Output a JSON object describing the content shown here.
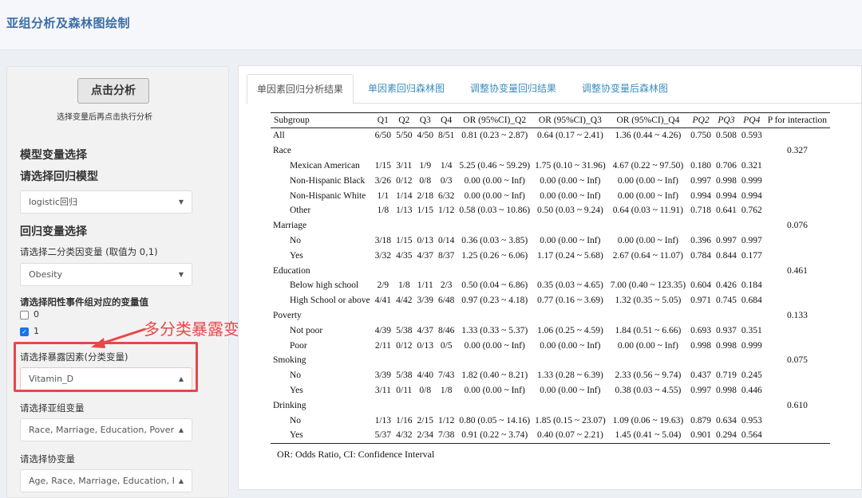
{
  "app": {
    "title": "亚组分析及森林图绘制"
  },
  "sidebar": {
    "analyze_button": "点击分析",
    "hint": "选择变量后再点击执行分析",
    "section_model": "模型变量选择",
    "model_label": "请选择回归模型",
    "model_value": "logistic回归",
    "section_reg": "回归变量选择",
    "binary_label": "请选择二分类因变量 (取值为 0,1)",
    "binary_value": "Obesity",
    "positive_label": "请选择阳性事件组对应的变量值",
    "positive_options": [
      {
        "label": "0",
        "checked": false
      },
      {
        "label": "1",
        "checked": true
      }
    ],
    "exposure_label": "请选择暴露因素(分类变量)",
    "exposure_value": "Vitamin_D",
    "subgroup_label": "请选择亚组变量",
    "subgroup_value": "Race, Marriage, Education, Poverty,",
    "covariate_label": "请选择协变量",
    "covariate_value": "Age, Race, Marriage, Education, Pove",
    "annotation": "多分类暴露变量",
    "annotation_color": "#e8474a"
  },
  "tabs": [
    {
      "label": "单因素回归分析结果",
      "active": true
    },
    {
      "label": "单因素回归森林图",
      "active": false
    },
    {
      "label": "调整协变量回归结果",
      "active": false
    },
    {
      "label": "调整协变量后森林图",
      "active": false
    }
  ],
  "table": {
    "headers": [
      "Subgroup",
      "Q1",
      "Q2",
      "Q3",
      "Q4",
      "OR (95%CI)_Q2",
      "OR (95%CI)_Q3",
      "OR (95%CI)_Q4",
      "PQ2",
      "PQ3",
      "PQ4",
      "P for interaction"
    ],
    "rows": [
      [
        "All",
        "6/50",
        "5/50",
        "4/50",
        "8/51",
        "0.81 (0.23 ~ 2.87)",
        "0.64 (0.17 ~ 2.41)",
        "1.36 (0.44 ~ 4.26)",
        "0.750",
        "0.508",
        "0.593",
        ""
      ],
      [
        "Race",
        "",
        "",
        "",
        "",
        "",
        "",
        "",
        "",
        "",
        "",
        "0.327"
      ],
      [
        "Mexican American",
        "1/15",
        "3/11",
        "1/9",
        "1/4",
        "5.25 (0.46 ~ 59.29)",
        "1.75 (0.10 ~ 31.96)",
        "4.67 (0.22 ~ 97.50)",
        "0.180",
        "0.706",
        "0.321",
        ""
      ],
      [
        "Non-Hispanic Black",
        "3/26",
        "0/12",
        "0/8",
        "0/3",
        "0.00 (0.00 ~ Inf)",
        "0.00 (0.00 ~ Inf)",
        "0.00 (0.00 ~ Inf)",
        "0.997",
        "0.998",
        "0.999",
        ""
      ],
      [
        "Non-Hispanic White",
        "1/1",
        "1/14",
        "2/18",
        "6/32",
        "0.00 (0.00 ~ Inf)",
        "0.00 (0.00 ~ Inf)",
        "0.00 (0.00 ~ Inf)",
        "0.994",
        "0.994",
        "0.994",
        ""
      ],
      [
        "Other",
        "1/8",
        "1/13",
        "1/15",
        "1/12",
        "0.58 (0.03 ~ 10.86)",
        "0.50 (0.03 ~ 9.24)",
        "0.64 (0.03 ~ 11.91)",
        "0.718",
        "0.641",
        "0.762",
        ""
      ],
      [
        "Marriage",
        "",
        "",
        "",
        "",
        "",
        "",
        "",
        "",
        "",
        "",
        "0.076"
      ],
      [
        "No",
        "3/18",
        "1/15",
        "0/13",
        "0/14",
        "0.36 (0.03 ~ 3.85)",
        "0.00 (0.00 ~ Inf)",
        "0.00 (0.00 ~ Inf)",
        "0.396",
        "0.997",
        "0.997",
        ""
      ],
      [
        "Yes",
        "3/32",
        "4/35",
        "4/37",
        "8/37",
        "1.25 (0.26 ~ 6.06)",
        "1.17 (0.24 ~ 5.68)",
        "2.67 (0.64 ~ 11.07)",
        "0.784",
        "0.844",
        "0.177",
        ""
      ],
      [
        "Education",
        "",
        "",
        "",
        "",
        "",
        "",
        "",
        "",
        "",
        "",
        "0.461"
      ],
      [
        "Below high school",
        "2/9",
        "1/8",
        "1/11",
        "2/3",
        "0.50 (0.04 ~ 6.86)",
        "0.35 (0.03 ~ 4.65)",
        "7.00 (0.40 ~ 123.35)",
        "0.604",
        "0.426",
        "0.184",
        ""
      ],
      [
        "High School or above",
        "4/41",
        "4/42",
        "3/39",
        "6/48",
        "0.97 (0.23 ~ 4.18)",
        "0.77 (0.16 ~ 3.69)",
        "1.32 (0.35 ~ 5.05)",
        "0.971",
        "0.745",
        "0.684",
        ""
      ],
      [
        "Poverty",
        "",
        "",
        "",
        "",
        "",
        "",
        "",
        "",
        "",
        "",
        "0.133"
      ],
      [
        "Not poor",
        "4/39",
        "5/38",
        "4/37",
        "8/46",
        "1.33 (0.33 ~ 5.37)",
        "1.06 (0.25 ~ 4.59)",
        "1.84 (0.51 ~ 6.66)",
        "0.693",
        "0.937",
        "0.351",
        ""
      ],
      [
        "Poor",
        "2/11",
        "0/12",
        "0/13",
        "0/5",
        "0.00 (0.00 ~ Inf)",
        "0.00 (0.00 ~ Inf)",
        "0.00 (0.00 ~ Inf)",
        "0.998",
        "0.998",
        "0.999",
        ""
      ],
      [
        "Smoking",
        "",
        "",
        "",
        "",
        "",
        "",
        "",
        "",
        "",
        "",
        "0.075"
      ],
      [
        "No",
        "3/39",
        "5/38",
        "4/40",
        "7/43",
        "1.82 (0.40 ~ 8.21)",
        "1.33 (0.28 ~ 6.39)",
        "2.33 (0.56 ~ 9.74)",
        "0.437",
        "0.719",
        "0.245",
        ""
      ],
      [
        "Yes",
        "3/11",
        "0/11",
        "0/8",
        "1/8",
        "0.00 (0.00 ~ Inf)",
        "0.00 (0.00 ~ Inf)",
        "0.38 (0.03 ~ 4.55)",
        "0.997",
        "0.998",
        "0.446",
        ""
      ],
      [
        "Drinking",
        "",
        "",
        "",
        "",
        "",
        "",
        "",
        "",
        "",
        "",
        "0.610"
      ],
      [
        "No",
        "1/13",
        "1/16",
        "2/15",
        "1/12",
        "0.80 (0.05 ~ 14.16)",
        "1.85 (0.15 ~ 23.07)",
        "1.09 (0.06 ~ 19.63)",
        "0.879",
        "0.634",
        "0.953",
        ""
      ],
      [
        "Yes",
        "5/37",
        "4/32",
        "2/34",
        "7/38",
        "0.91 (0.22 ~ 3.74)",
        "0.40 (0.07 ~ 2.21)",
        "1.45 (0.41 ~ 5.04)",
        "0.901",
        "0.294",
        "0.564",
        ""
      ]
    ],
    "footnote": "OR: Odds Ratio, CI: Confidence Interval"
  }
}
